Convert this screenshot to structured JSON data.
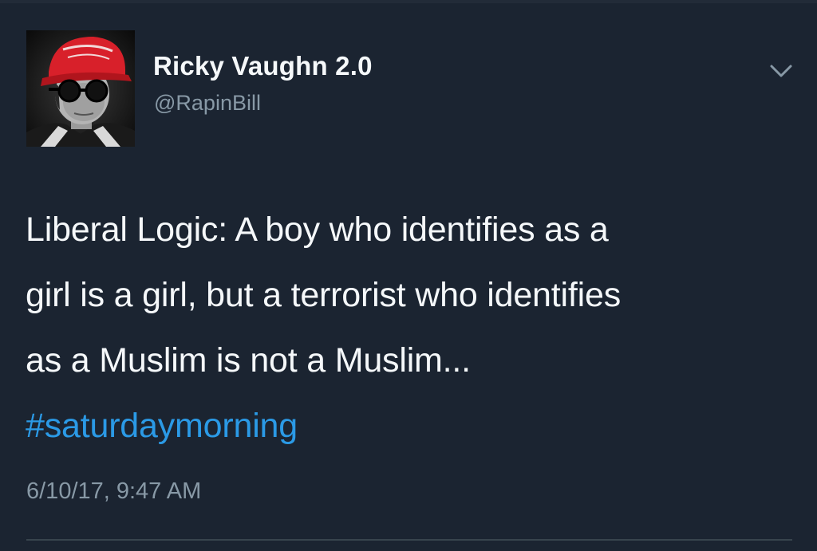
{
  "tweet": {
    "author": {
      "display_name": "Ricky Vaughn 2.0",
      "handle": "@RapinBill",
      "avatar_icon": "user-avatar-photo"
    },
    "text_lines": [
      "Liberal Logic: A boy who identifies as a",
      "girl is a girl, but a terrorist who identifies",
      "as a Muslim is not a Muslim..."
    ],
    "hashtag": "#saturdaymorning",
    "timestamp": "6/10/17, 9:47 AM",
    "menu_icon": "chevron-down-icon"
  },
  "colors": {
    "background": "#1b2431",
    "text_primary": "#f5f8fa",
    "text_secondary": "#8899a6",
    "link": "#2b9ae6",
    "divider": "#38444d"
  }
}
